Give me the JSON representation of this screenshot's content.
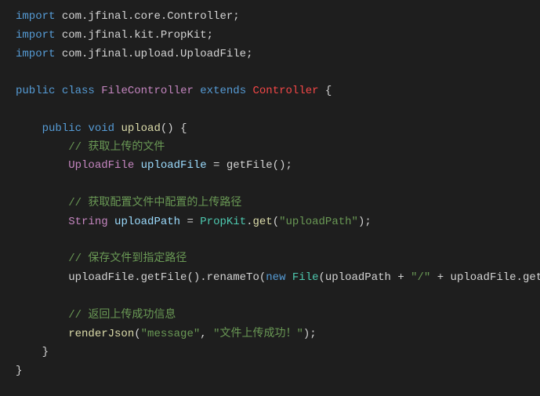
{
  "code": {
    "line1": {
      "import": "import",
      "package": "com.jfinal.core.Controller;"
    },
    "line2": {
      "import": "import",
      "package": "com.jfinal.kit.PropKit;"
    },
    "line3": {
      "import": "import",
      "package": "com.jfinal.upload.UploadFile;"
    },
    "line5": {
      "public": "public",
      "class": "class",
      "classname": "FileController",
      "extends": "extends",
      "superclass": "Controller",
      "brace": " {"
    },
    "line7": {
      "indent": "    ",
      "public": "public",
      "void": "void",
      "method": "upload",
      "params": "() {"
    },
    "line8": {
      "indent": "        ",
      "comment": "// 获取上传的文件"
    },
    "line9": {
      "indent": "        ",
      "type": "UploadFile",
      "varname": "uploadFile",
      "equals": " = ",
      "call": "getFile();"
    },
    "line11": {
      "indent": "        ",
      "comment": "// 获取配置文件中配置的上传路径"
    },
    "line12": {
      "indent": "        ",
      "type": "String",
      "varname": "uploadPath",
      "equals": " = ",
      "class": "PropKit",
      "dot": ".",
      "method": "get",
      "open": "(",
      "str": "\"uploadPath\"",
      "close": ");"
    },
    "line14": {
      "indent": "        ",
      "comment": "// 保存文件到指定路径"
    },
    "line15": {
      "indent": "        ",
      "part1": "uploadFile.getFile().renameTo(",
      "new": "new",
      "space": " ",
      "class": "File",
      "open": "(uploadPath + ",
      "str": "\"/\"",
      "plus": " + uploadFile.getFileNa"
    },
    "line17": {
      "indent": "        ",
      "comment": "// 返回上传成功信息"
    },
    "line18": {
      "indent": "        ",
      "method": "renderJson",
      "open": "(",
      "str1": "\"message\"",
      "comma": ", ",
      "str2": "\"文件上传成功！\"",
      "close": ");"
    },
    "line19": {
      "indent": "    ",
      "brace": "}"
    },
    "line20": {
      "brace": "}"
    }
  }
}
